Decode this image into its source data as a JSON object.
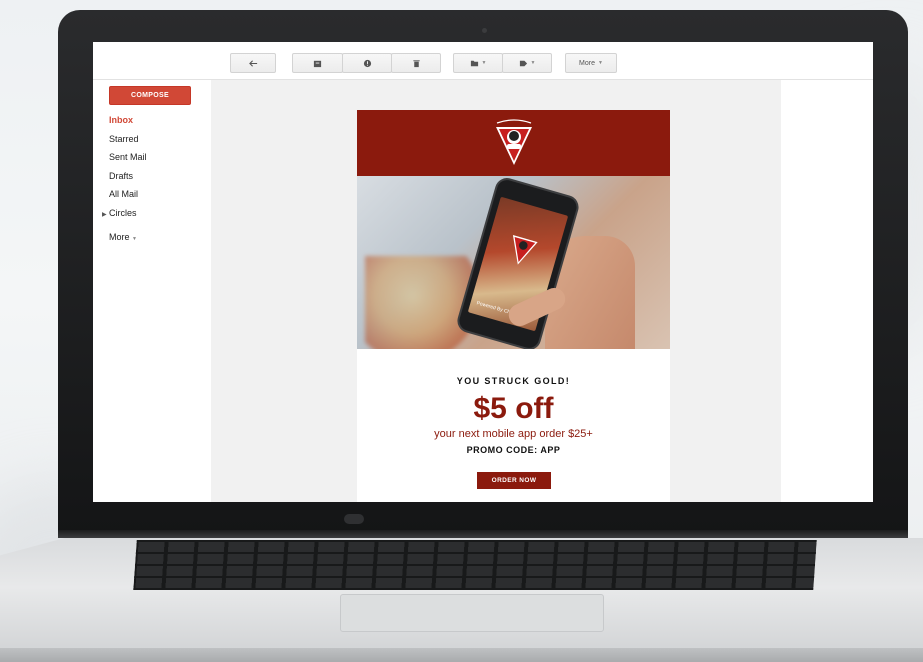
{
  "toolbar": {
    "more_label": "More"
  },
  "sidebar": {
    "compose_label": "COMPOSE",
    "items": [
      {
        "label": "Inbox"
      },
      {
        "label": "Starred"
      },
      {
        "label": "Sent Mail"
      },
      {
        "label": "Drafts"
      },
      {
        "label": "All Mail"
      },
      {
        "label": "Circles"
      }
    ],
    "more_label": "More"
  },
  "email": {
    "headline_top": "YOU STRUCK GOLD!",
    "offer": "$5 off",
    "offer_detail": "your next mobile app order $25+",
    "promo": "PROMO CODE: APP",
    "cta_label": "ORDER NOW",
    "phone_caption": "Powered By ChowNow"
  },
  "colors": {
    "brand_red": "#8b1a0d",
    "compose_red": "#d14836",
    "inbox_active": "#d14836"
  },
  "icons": [
    "reply-icon",
    "archive-icon",
    "spam-icon",
    "trash-icon",
    "folder-icon",
    "label-icon"
  ]
}
